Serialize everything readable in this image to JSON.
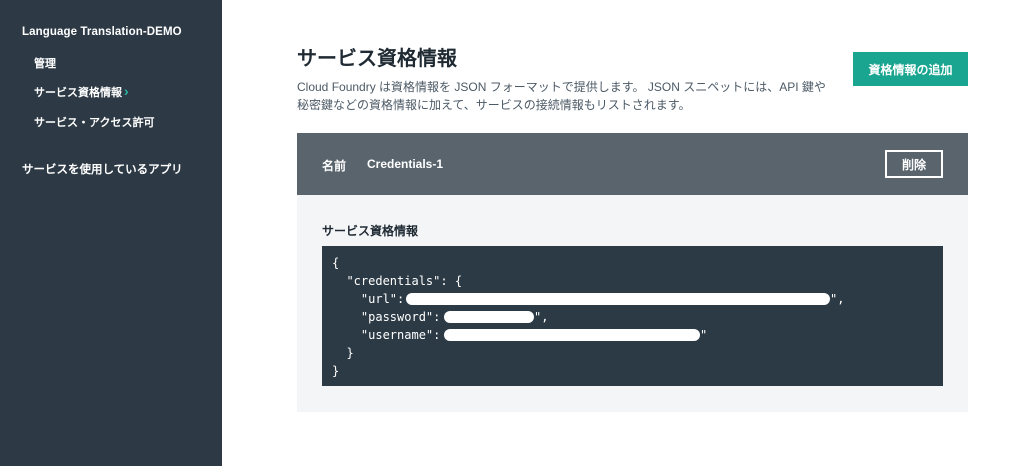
{
  "sidebar": {
    "service_title": "Language Translation-DEMO",
    "items": [
      {
        "label": "管理"
      },
      {
        "label": "サービス資格情報",
        "active": true
      },
      {
        "label": "サービス・アクセス許可"
      }
    ],
    "active_indicator": "›",
    "connected_apps_label": "サービスを使用しているアプリ"
  },
  "main": {
    "title": "サービス資格情報",
    "description": "Cloud Foundry は資格情報を JSON フォーマットで提供します。 JSON スニペットには、API 鍵や秘密鍵などの資格情報に加えて、サービスの接続情報もリストされます。",
    "add_button_label": "資格情報の追加"
  },
  "credential": {
    "name_label": "名前",
    "name_value": "Credentials-1",
    "delete_button_label": "削除",
    "section_label": "サービス資格情報",
    "json_lines": [
      "{",
      "  \"credentials\": {",
      "    \"url\": \"",
      "    \"password\": \"",
      "    \"username\": \"",
      "  }",
      "}"
    ],
    "url_suffix": "\",",
    "password_suffix": "\",",
    "username_suffix": "\""
  },
  "colors": {
    "sidebar_bg": "#2d3a45",
    "accent": "#1aa590",
    "card_header_bg": "#59646d",
    "code_bg": "#2b3a45"
  }
}
